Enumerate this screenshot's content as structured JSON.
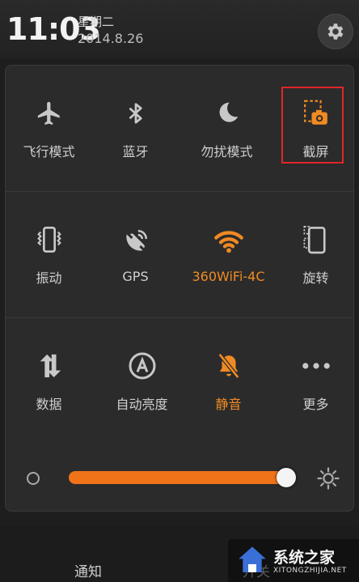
{
  "status": {
    "time": "11:03",
    "weekday": "星期二",
    "date": "2014.8.26"
  },
  "toggles": {
    "airplane": {
      "label": "飞行模式",
      "icon": "airplane-icon",
      "active": false
    },
    "bluetooth": {
      "label": "蓝牙",
      "icon": "bluetooth-icon",
      "active": false
    },
    "dnd": {
      "label": "勿扰模式",
      "icon": "moon-icon",
      "active": false
    },
    "screenshot": {
      "label": "截屏",
      "icon": "screenshot-icon",
      "active": true
    },
    "vibrate": {
      "label": "振动",
      "icon": "vibrate-icon",
      "active": false
    },
    "gps": {
      "label": "GPS",
      "icon": "gps-icon",
      "active": false
    },
    "wifi": {
      "label": "360WiFi-4C",
      "icon": "wifi-icon",
      "active": true
    },
    "rotate": {
      "label": "旋转",
      "icon": "rotate-icon",
      "active": false
    },
    "data": {
      "label": "数据",
      "icon": "data-icon",
      "active": false
    },
    "auto_brightness": {
      "label": "自动亮度",
      "icon": "auto-brightness-icon",
      "active": false
    },
    "mute": {
      "label": "静音",
      "icon": "mute-icon",
      "active": true
    },
    "more": {
      "label": "更多",
      "icon": "more-icon",
      "active": false
    }
  },
  "brightness": {
    "level": 0.96
  },
  "tabs": {
    "notify": "通知",
    "switch": "开关"
  },
  "watermark": {
    "text": "系统之家",
    "url": "XITONGZHIJIA.NET"
  },
  "colors": {
    "accent": "#f08a24",
    "highlight": "#e0262a",
    "icon": "#c8c8c8"
  }
}
